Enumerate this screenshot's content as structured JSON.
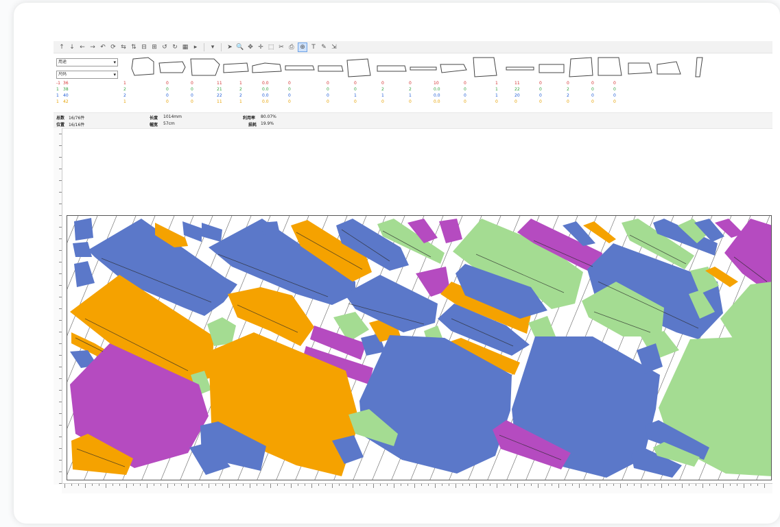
{
  "toolbar": {
    "icons": [
      "arrow-icon",
      "arrow-down-icon",
      "arrow-left-icon",
      "arrow-right-icon",
      "undo-icon",
      "rotate-icon",
      "flip-h-icon",
      "flip-v-icon",
      "align-icon",
      "align-right-icon",
      "rotate-left-icon",
      "rotate-right-icon",
      "grid-icon",
      "play-icon",
      "filter-icon",
      "pointer-icon",
      "zoom-icon",
      "move-icon",
      "pan-icon",
      "select-icon",
      "cut-icon",
      "print-icon",
      "auto-nest-icon",
      "text-icon",
      "pencil-icon",
      "measure-icon"
    ],
    "active_icon": "auto-nest-icon"
  },
  "selects": {
    "first": "用途",
    "second": "尺码"
  },
  "stats_rows": [
    {
      "size": "36",
      "color": "#d32f2f",
      "values": [
        "1",
        "0",
        "0",
        "11",
        "1",
        "0.0",
        "0",
        "0",
        "0",
        "0",
        "0",
        "10",
        "0",
        "1",
        "11",
        "0",
        "0",
        "0",
        "0"
      ]
    },
    {
      "size": "38",
      "color": "#2e9f3a",
      "values": [
        "2",
        "0",
        "0",
        "21",
        "2",
        "0.0",
        "0",
        "0",
        "0",
        "2",
        "2",
        "0.0",
        "0",
        "1",
        "22",
        "0",
        "2",
        "0",
        "0"
      ]
    },
    {
      "size": "40",
      "color": "#1e5bd6",
      "values": [
        "2",
        "0",
        "0",
        "22",
        "2",
        "0.0",
        "0",
        "0",
        "1",
        "1",
        "1",
        "0.0",
        "0",
        "1",
        "20",
        "0",
        "2",
        "0",
        "0"
      ]
    },
    {
      "size": "42",
      "color": "#e6a100",
      "values": [
        "1",
        "0",
        "0",
        "11",
        "1",
        "0.0",
        "0",
        "0",
        "0",
        "0",
        "0",
        "0.0",
        "0",
        "0",
        "0",
        "0",
        "0",
        "0",
        "0"
      ]
    }
  ],
  "stats_first_col": [
    "-1",
    "1",
    "1",
    "1"
  ],
  "info": {
    "label1": "总数",
    "val1": "16/76件",
    "label2": "位置",
    "val2": "16/16件",
    "label3": "长度",
    "val3": "1014mm",
    "label4": "幅宽",
    "val4": "57cm",
    "label5": "利用率",
    "val5": "80.07%",
    "label6": "损耗",
    "val6": "19.9%"
  },
  "colors": {
    "blue": "#5b78c9",
    "orange": "#f5a200",
    "green": "#a4dc92",
    "purple": "#b54bc0",
    "active": "#cfe2fb"
  }
}
